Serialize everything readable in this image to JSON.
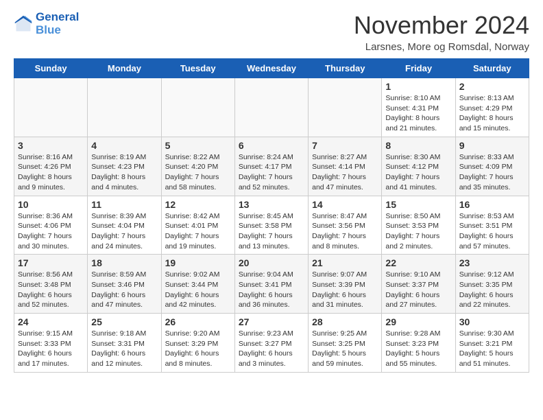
{
  "logo": {
    "line1": "General",
    "line2": "Blue"
  },
  "title": "November 2024",
  "subtitle": "Larsnes, More og Romsdal, Norway",
  "days_header": [
    "Sunday",
    "Monday",
    "Tuesday",
    "Wednesday",
    "Thursday",
    "Friday",
    "Saturday"
  ],
  "weeks": [
    [
      {
        "day": "",
        "detail": ""
      },
      {
        "day": "",
        "detail": ""
      },
      {
        "day": "",
        "detail": ""
      },
      {
        "day": "",
        "detail": ""
      },
      {
        "day": "",
        "detail": ""
      },
      {
        "day": "1",
        "detail": "Sunrise: 8:10 AM\nSunset: 4:31 PM\nDaylight: 8 hours and 21 minutes."
      },
      {
        "day": "2",
        "detail": "Sunrise: 8:13 AM\nSunset: 4:29 PM\nDaylight: 8 hours and 15 minutes."
      }
    ],
    [
      {
        "day": "3",
        "detail": "Sunrise: 8:16 AM\nSunset: 4:26 PM\nDaylight: 8 hours and 9 minutes."
      },
      {
        "day": "4",
        "detail": "Sunrise: 8:19 AM\nSunset: 4:23 PM\nDaylight: 8 hours and 4 minutes."
      },
      {
        "day": "5",
        "detail": "Sunrise: 8:22 AM\nSunset: 4:20 PM\nDaylight: 7 hours and 58 minutes."
      },
      {
        "day": "6",
        "detail": "Sunrise: 8:24 AM\nSunset: 4:17 PM\nDaylight: 7 hours and 52 minutes."
      },
      {
        "day": "7",
        "detail": "Sunrise: 8:27 AM\nSunset: 4:14 PM\nDaylight: 7 hours and 47 minutes."
      },
      {
        "day": "8",
        "detail": "Sunrise: 8:30 AM\nSunset: 4:12 PM\nDaylight: 7 hours and 41 minutes."
      },
      {
        "day": "9",
        "detail": "Sunrise: 8:33 AM\nSunset: 4:09 PM\nDaylight: 7 hours and 35 minutes."
      }
    ],
    [
      {
        "day": "10",
        "detail": "Sunrise: 8:36 AM\nSunset: 4:06 PM\nDaylight: 7 hours and 30 minutes."
      },
      {
        "day": "11",
        "detail": "Sunrise: 8:39 AM\nSunset: 4:04 PM\nDaylight: 7 hours and 24 minutes."
      },
      {
        "day": "12",
        "detail": "Sunrise: 8:42 AM\nSunset: 4:01 PM\nDaylight: 7 hours and 19 minutes."
      },
      {
        "day": "13",
        "detail": "Sunrise: 8:45 AM\nSunset: 3:58 PM\nDaylight: 7 hours and 13 minutes."
      },
      {
        "day": "14",
        "detail": "Sunrise: 8:47 AM\nSunset: 3:56 PM\nDaylight: 7 hours and 8 minutes."
      },
      {
        "day": "15",
        "detail": "Sunrise: 8:50 AM\nSunset: 3:53 PM\nDaylight: 7 hours and 2 minutes."
      },
      {
        "day": "16",
        "detail": "Sunrise: 8:53 AM\nSunset: 3:51 PM\nDaylight: 6 hours and 57 minutes."
      }
    ],
    [
      {
        "day": "17",
        "detail": "Sunrise: 8:56 AM\nSunset: 3:48 PM\nDaylight: 6 hours and 52 minutes."
      },
      {
        "day": "18",
        "detail": "Sunrise: 8:59 AM\nSunset: 3:46 PM\nDaylight: 6 hours and 47 minutes."
      },
      {
        "day": "19",
        "detail": "Sunrise: 9:02 AM\nSunset: 3:44 PM\nDaylight: 6 hours and 42 minutes."
      },
      {
        "day": "20",
        "detail": "Sunrise: 9:04 AM\nSunset: 3:41 PM\nDaylight: 6 hours and 36 minutes."
      },
      {
        "day": "21",
        "detail": "Sunrise: 9:07 AM\nSunset: 3:39 PM\nDaylight: 6 hours and 31 minutes."
      },
      {
        "day": "22",
        "detail": "Sunrise: 9:10 AM\nSunset: 3:37 PM\nDaylight: 6 hours and 27 minutes."
      },
      {
        "day": "23",
        "detail": "Sunrise: 9:12 AM\nSunset: 3:35 PM\nDaylight: 6 hours and 22 minutes."
      }
    ],
    [
      {
        "day": "24",
        "detail": "Sunrise: 9:15 AM\nSunset: 3:33 PM\nDaylight: 6 hours and 17 minutes."
      },
      {
        "day": "25",
        "detail": "Sunrise: 9:18 AM\nSunset: 3:31 PM\nDaylight: 6 hours and 12 minutes."
      },
      {
        "day": "26",
        "detail": "Sunrise: 9:20 AM\nSunset: 3:29 PM\nDaylight: 6 hours and 8 minutes."
      },
      {
        "day": "27",
        "detail": "Sunrise: 9:23 AM\nSunset: 3:27 PM\nDaylight: 6 hours and 3 minutes."
      },
      {
        "day": "28",
        "detail": "Sunrise: 9:25 AM\nSunset: 3:25 PM\nDaylight: 5 hours and 59 minutes."
      },
      {
        "day": "29",
        "detail": "Sunrise: 9:28 AM\nSunset: 3:23 PM\nDaylight: 5 hours and 55 minutes."
      },
      {
        "day": "30",
        "detail": "Sunrise: 9:30 AM\nSunset: 3:21 PM\nDaylight: 5 hours and 51 minutes."
      }
    ]
  ]
}
